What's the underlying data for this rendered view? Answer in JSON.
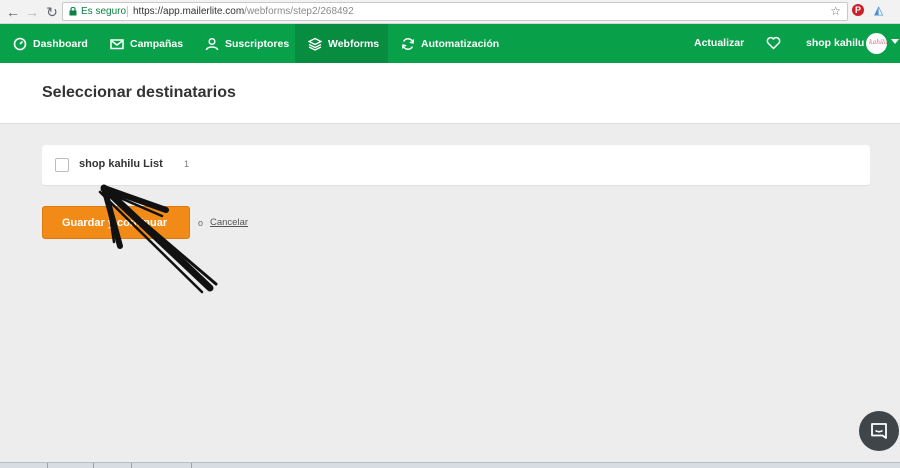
{
  "browser": {
    "secure_label": "Es seguro",
    "url_prefix": "https://app.mailerlite.com",
    "url_path": "/webforms/step2/268492"
  },
  "nav": {
    "dashboard": "Dashboard",
    "campaigns": "Campañas",
    "subscribers": "Suscriptores",
    "webforms": "Webforms",
    "automation": "Automatización",
    "upgrade": "Actualizar",
    "account_name": "shop kahilu",
    "avatar_text": "kahilu"
  },
  "page": {
    "title": "Seleccionar destinatarios"
  },
  "lists": [
    {
      "name": "shop kahilu List",
      "count": "1",
      "checked": false
    }
  ],
  "actions": {
    "save_label": "Guardar y continuar",
    "or_text": "o",
    "cancel_label": "Cancelar"
  },
  "colors": {
    "brand_green": "#09a04a",
    "active_nav": "#078c40",
    "primary_button": "#f28a18",
    "page_background": "#ededed"
  }
}
